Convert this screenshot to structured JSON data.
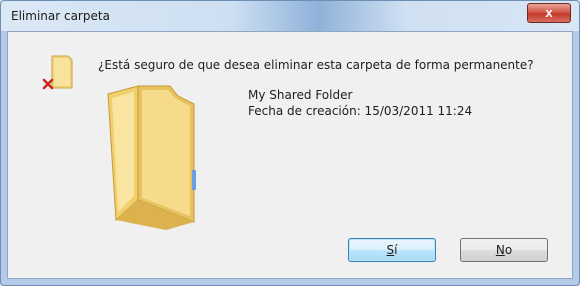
{
  "window": {
    "title": "Eliminar carpeta",
    "close_label": "x"
  },
  "message": {
    "question": "¿Está seguro de que desea eliminar esta carpeta de forma permanente?",
    "item_name": "My Shared Folder",
    "item_date": "Fecha de creación: 15/03/2011 11:24"
  },
  "buttons": {
    "yes": {
      "mnemonic": "S",
      "rest": "í"
    },
    "no": {
      "mnemonic": "N",
      "rest": "o"
    }
  },
  "icons": {
    "small": "folder-delete-icon",
    "large": "folder-icon"
  },
  "colors": {
    "title_bar": "#c6d9ef",
    "close_button": "#c23b2c",
    "content_background": "#f0f0f0",
    "default_button_border": "#3c7fb1",
    "delete_mark": "#c8281e",
    "folder_yellow": "#f4d57a"
  }
}
